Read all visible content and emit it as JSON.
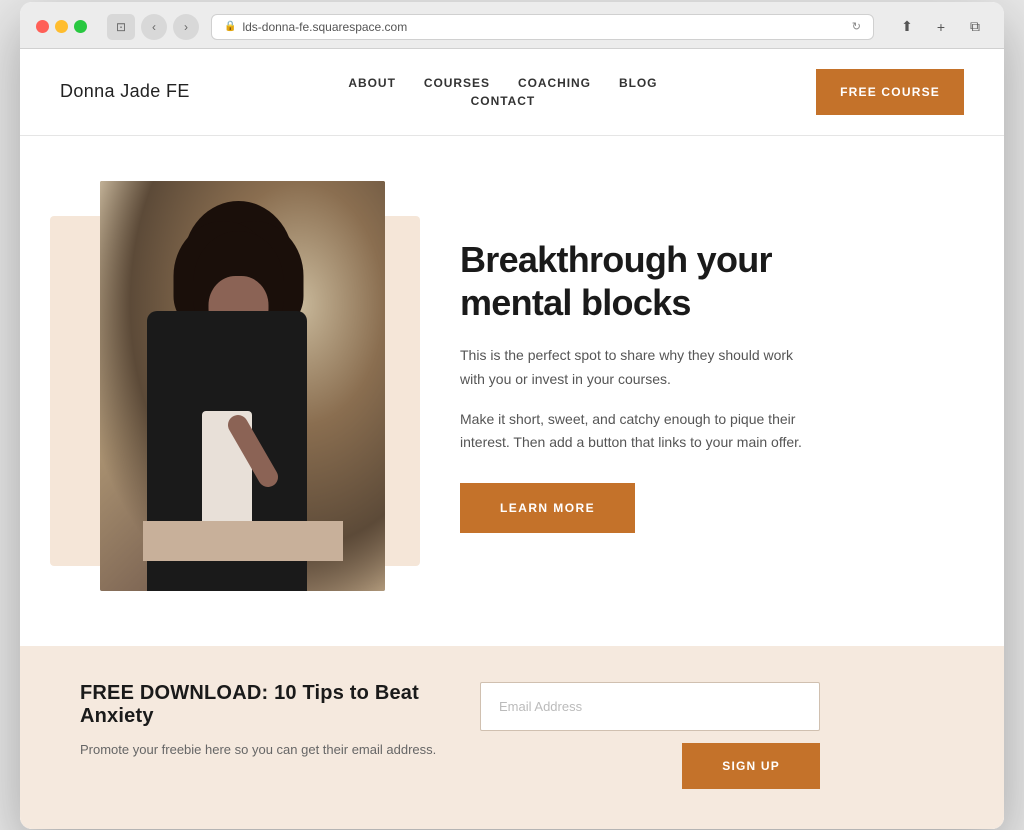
{
  "browser": {
    "url": "lds-donna-fe.squarespace.com",
    "dots": [
      "red",
      "yellow",
      "green"
    ]
  },
  "header": {
    "logo": "Donna Jade FE",
    "nav": {
      "row1": [
        {
          "label": "ABOUT"
        },
        {
          "label": "COURSES"
        },
        {
          "label": "COACHING"
        },
        {
          "label": "BLOG"
        }
      ],
      "row2": [
        {
          "label": "CONTACT"
        }
      ]
    },
    "cta_button": "FREE COURSE"
  },
  "hero": {
    "title": "Breakthrough your mental blocks",
    "desc1": "This is the perfect spot to share why they should work with you or invest in your courses.",
    "desc2": "Make it short, sweet, and catchy enough to pique their interest. Then add a button that links to your main offer.",
    "cta_button": "LEARN MORE"
  },
  "download": {
    "title": "FREE DOWNLOAD: 10 Tips to Beat Anxiety",
    "description": "Promote your freebie here so you can get their email address.",
    "email_placeholder": "Email Address",
    "signup_button": "SIGN UP"
  }
}
